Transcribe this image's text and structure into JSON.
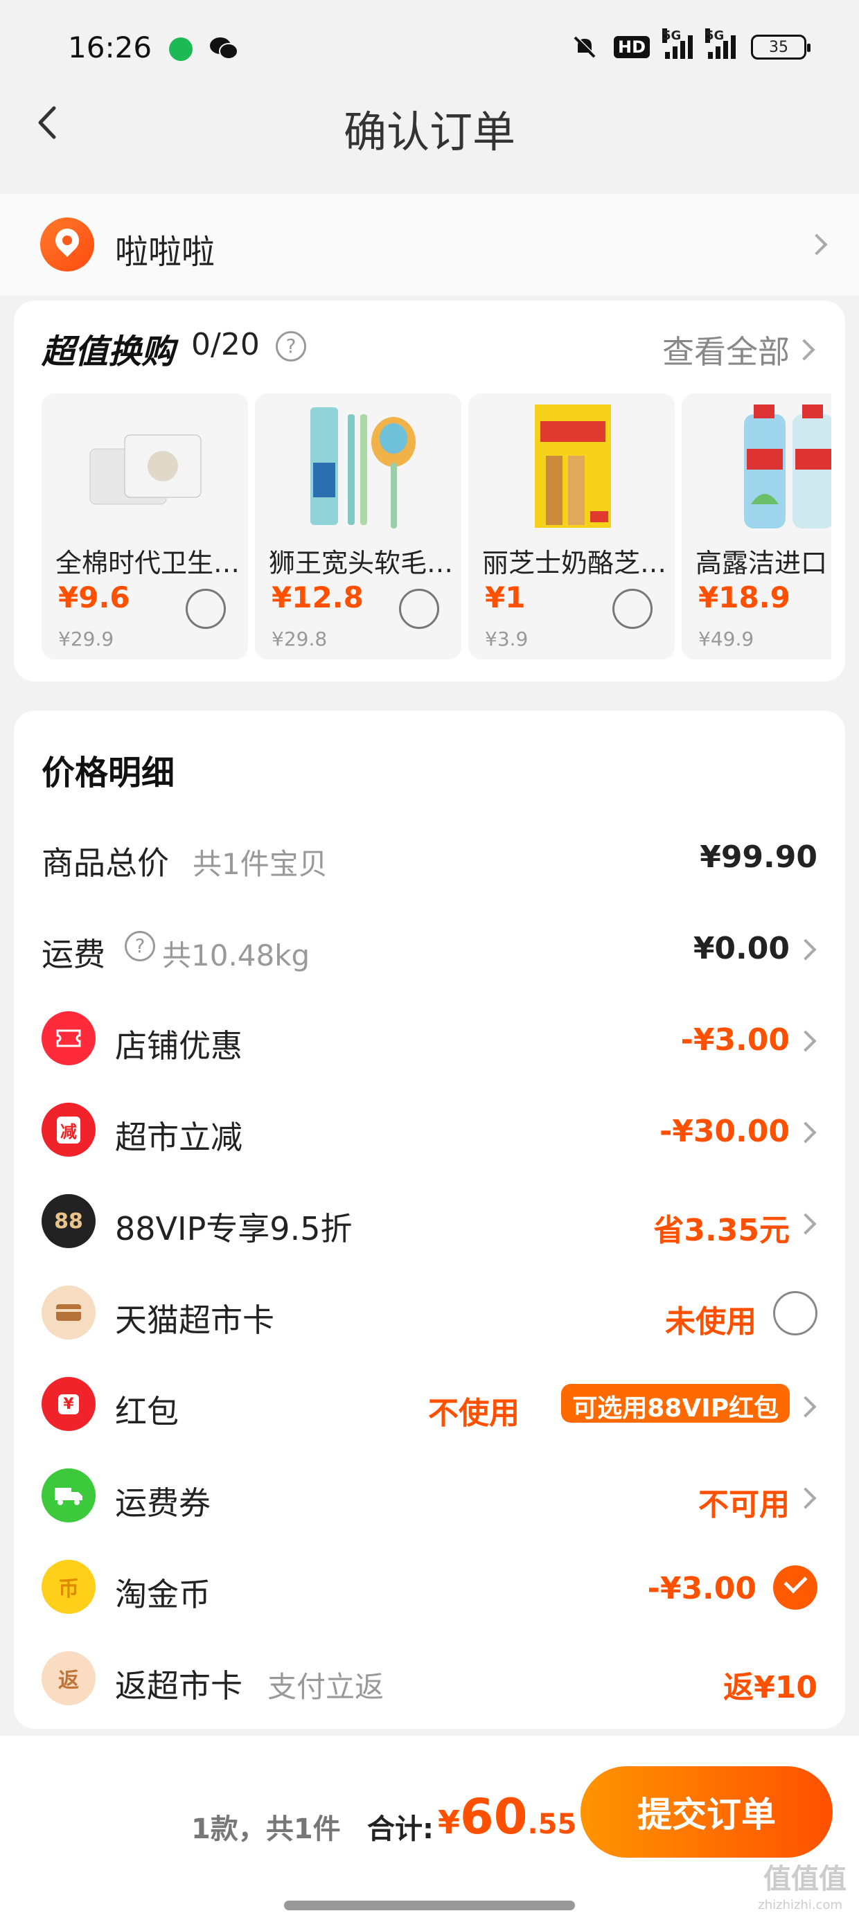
{
  "status_bar": {
    "time": "16:26",
    "network1": "5G",
    "network2": "5G",
    "hd": "HD",
    "battery": "35"
  },
  "nav": {
    "title": "确认订单"
  },
  "address": {
    "name": "啦啦啦"
  },
  "exchange": {
    "title": "超值换购",
    "count": "0/20",
    "help": "?",
    "view_all": "查看全部",
    "products": [
      {
        "name": "全棉时代卫生…",
        "price": "¥9.6",
        "orig": "¥29.9"
      },
      {
        "name": "狮王宽头软毛…",
        "price": "¥12.8",
        "orig": "¥29.8"
      },
      {
        "name": "丽芝士奶酪芝…",
        "price": "¥1",
        "orig": "¥3.9"
      },
      {
        "name": "高露洁进口",
        "price": "¥18.9",
        "orig": "¥49.9"
      }
    ]
  },
  "detail": {
    "title": "价格明细",
    "goods_label": "商品总价",
    "goods_sub": "共1件宝贝",
    "goods_value": "¥99.90",
    "freight_label": "运费",
    "freight_sub": "共10.48kg",
    "freight_value": "¥0.00",
    "rows": [
      {
        "label": "店铺优惠",
        "value": "-¥3.00",
        "icon_text": ""
      },
      {
        "label": "超市立减",
        "value": "-¥30.00",
        "icon_text": "减"
      },
      {
        "label": "88VIP专享9.5折",
        "value": "省3.35元",
        "icon_text": "88"
      },
      {
        "label": "天猫超市卡",
        "value": "未使用",
        "icon_text": ""
      },
      {
        "label": "红包",
        "value": "不使用",
        "badge": "可选用88VIP红包",
        "icon_text": "¥"
      },
      {
        "label": "运费券",
        "value": "不可用",
        "icon_text": ""
      },
      {
        "label": "淘金币",
        "value": "-¥3.00",
        "icon_text": "币"
      },
      {
        "label": "返超市卡",
        "sub": "支付立返",
        "value": "返¥10",
        "icon_text": "返"
      }
    ]
  },
  "bottom": {
    "summary": "1款，共1件",
    "total_label": "合计:",
    "currency": "¥",
    "total_int": "60",
    "total_dec": ".55",
    "submit": "提交订单"
  },
  "watermark": {
    "text": "值值值",
    "sub": "zhizhizhi.com"
  },
  "colors": {
    "accent": "#ff5000",
    "background": "#f2f2f2"
  }
}
